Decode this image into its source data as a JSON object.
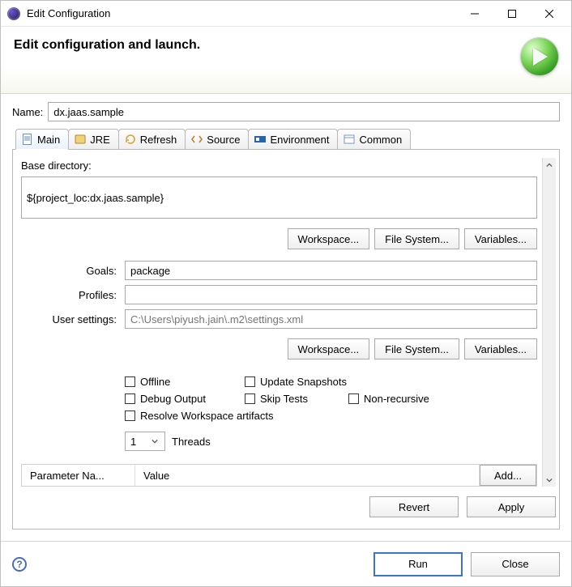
{
  "window": {
    "title": "Edit Configuration"
  },
  "banner": {
    "heading": "Edit configuration and launch."
  },
  "name": {
    "label": "Name:",
    "value": "dx.jaas.sample"
  },
  "tabs": [
    {
      "label": "Main",
      "active": true
    },
    {
      "label": "JRE",
      "active": false
    },
    {
      "label": "Refresh",
      "active": false
    },
    {
      "label": "Source",
      "active": false
    },
    {
      "label": "Environment",
      "active": false
    },
    {
      "label": "Common",
      "active": false
    }
  ],
  "main": {
    "base_dir_label": "Base directory:",
    "base_dir_value": "${project_loc:dx.jaas.sample}",
    "workspace_btn": "Workspace...",
    "filesystem_btn": "File System...",
    "variables_btn": "Variables...",
    "goals_label": "Goals:",
    "goals_value": "package",
    "profiles_label": "Profiles:",
    "profiles_value": "",
    "usersettings_label": "User settings:",
    "usersettings_placeholder": "C:\\Users\\piyush.jain\\.m2\\settings.xml",
    "checks": {
      "offline": "Offline",
      "update_snapshots": "Update Snapshots",
      "debug_output": "Debug Output",
      "skip_tests": "Skip Tests",
      "non_recursive": "Non-recursive",
      "resolve_workspace": "Resolve Workspace artifacts"
    },
    "threads": {
      "value": "1",
      "label": "Threads"
    },
    "param_table": {
      "name_header": "Parameter Na...",
      "value_header": "Value",
      "add_btn": "Add..."
    }
  },
  "revert_btn": "Revert",
  "apply_btn": "Apply",
  "run_btn": "Run",
  "close_btn": "Close"
}
